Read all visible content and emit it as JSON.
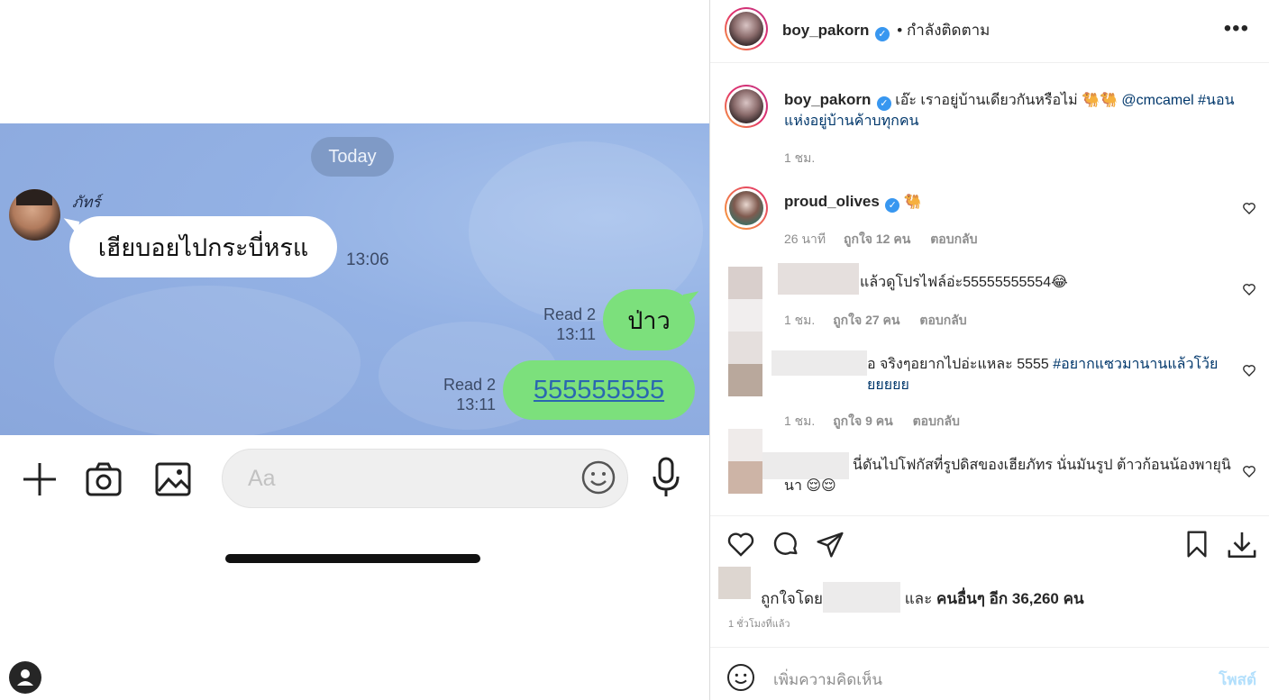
{
  "chat": {
    "date_pill": "Today",
    "sender_name": "ภัทร์",
    "incoming": {
      "text": "เฮียบอยไปกระบี่หรแ",
      "time": "13:06"
    },
    "outgoing": [
      {
        "text": "ป่าว",
        "read": "Read 2",
        "time": "13:11"
      },
      {
        "text": "555555555",
        "read": "Read 2",
        "time": "13:11"
      }
    ],
    "input_placeholder": "Aa"
  },
  "post": {
    "header": {
      "username": "boy_pakorn",
      "follow_status": "• กำลังติดตาม",
      "more": "•••"
    },
    "caption": {
      "username": "boy_pakorn",
      "text": "เอ๊ะ เราอยู่บ้านเดียวกันหรือไม่ 🐫🐫 ",
      "mention": "@cmcamel",
      "hashtag": "#นอนแห่งอยู่บ้านค้าบทุกคน",
      "time": "1 ชม."
    },
    "comments": [
      {
        "username": "proud_olives",
        "text": "🐫",
        "time": "26 นาที",
        "likes": "ถูกใจ 12 คน",
        "reply": "ตอบกลับ"
      },
      {
        "username": "",
        "text": "แล้วดูโปรไฟล์อ่ะ55555555554😂",
        "time": "1 ชม.",
        "likes": "ถูกใจ 27 คน",
        "reply": "ตอบกลับ"
      },
      {
        "username": "",
        "text": "อ จริงๆอยากไปอ่ะแหละ 5555 ",
        "hashtag": "#อยากแซวมานานแล้วโว้ยยยยยย",
        "time": "1 ชม.",
        "likes": "ถูกใจ 9 คน",
        "reply": "ตอบกลับ"
      },
      {
        "username": "",
        "text": "นี่ดันไปโฟกัสที่รูปดิสของเฮียภัทร นั่นมันรูป ต้าวก้อนน้องพายุนินา 😌😌"
      }
    ],
    "likes": {
      "prefix": "ถูกใจโดย",
      "and": "และ",
      "others": "คนอื่นๆ อีก 36,260 คน"
    },
    "posted_ago": "1 ชั่วโมงที่แล้ว",
    "comment_placeholder": "เพิ่มความคิดเห็น",
    "post_button": "โพสต์"
  }
}
